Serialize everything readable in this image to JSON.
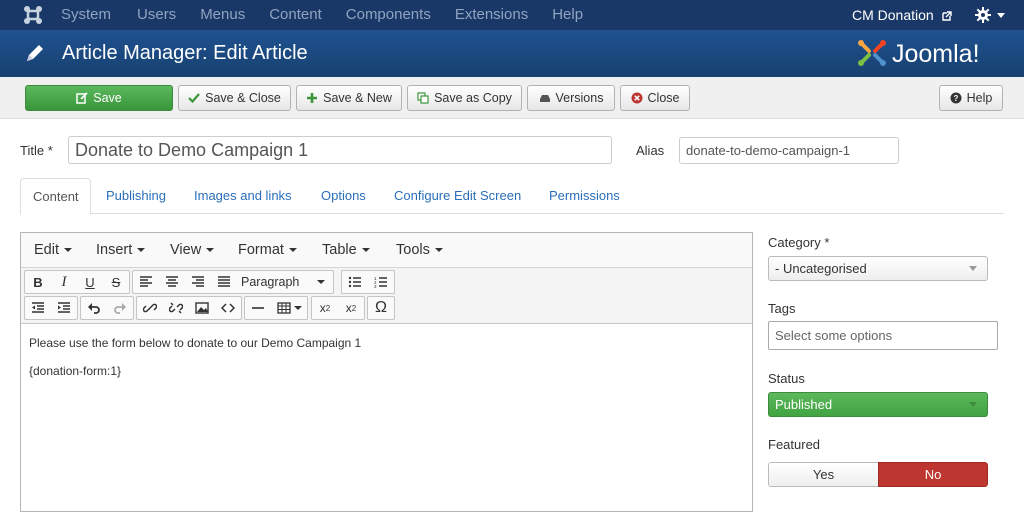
{
  "topnav": {
    "menu": [
      "System",
      "Users",
      "Menus",
      "Content",
      "Components",
      "Extensions",
      "Help"
    ],
    "site_name": "CM Donation"
  },
  "header": {
    "title": "Article Manager: Edit Article",
    "brand": "Joomla!"
  },
  "toolbar": {
    "save": "Save",
    "save_close": "Save & Close",
    "save_new": "Save & New",
    "save_copy": "Save as Copy",
    "versions": "Versions",
    "close": "Close",
    "help": "Help"
  },
  "form": {
    "title_label": "Title *",
    "title_value": "Donate to Demo Campaign 1",
    "alias_label": "Alias",
    "alias_value": "donate-to-demo-campaign-1"
  },
  "tabs": [
    "Content",
    "Publishing",
    "Images and links",
    "Options",
    "Configure Edit Screen",
    "Permissions"
  ],
  "editor": {
    "menus": [
      "Edit",
      "Insert",
      "View",
      "Format",
      "Table",
      "Tools"
    ],
    "format_select": "Paragraph",
    "content": [
      "Please use the form below to donate to our Demo Campaign 1",
      "{donation-form:1}"
    ]
  },
  "sidebar": {
    "category_label": "Category *",
    "category_value": "- Uncategorised",
    "tags_label": "Tags",
    "tags_placeholder": "Select some options",
    "status_label": "Status",
    "status_value": "Published",
    "featured_label": "Featured",
    "featured_yes": "Yes",
    "featured_no": "No"
  },
  "colors": {
    "navbar": "#1a3867",
    "header": "#1d4b86",
    "save_green": "#4cae4c",
    "no_red": "#bd362f",
    "link": "#2a6ebb"
  }
}
